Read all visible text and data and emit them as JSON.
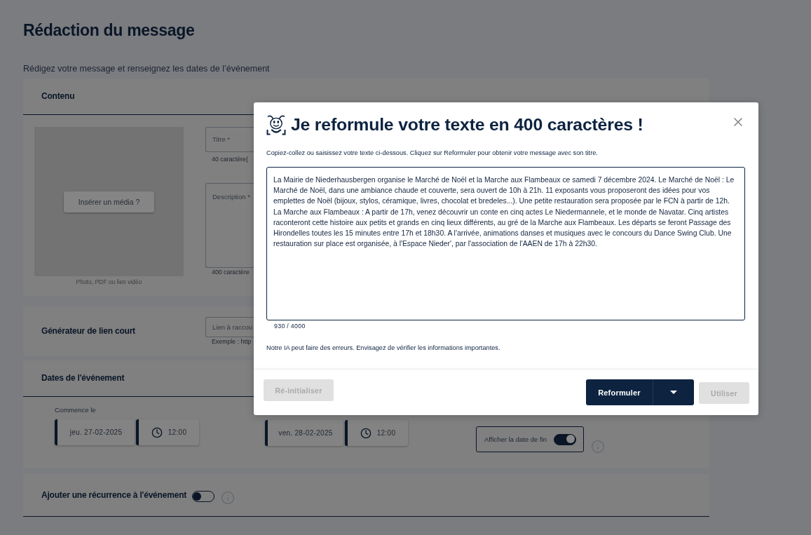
{
  "page": {
    "title": "Rédaction du message",
    "subtitle": "Rédigez votre message et renseignez les dates de l’événement"
  },
  "content_section": {
    "title": "Contenu",
    "media": {
      "button": "Insérer un média ?",
      "caption": "Photo, PDF ou lien vidéo"
    },
    "fields": [
      {
        "kind": "short",
        "label": "Titre *",
        "hint": "40 caractère("
      },
      {
        "kind": "long",
        "label": "Description *",
        "hint": "400 caractère"
      }
    ]
  },
  "short_link_section": {
    "title": "Générateur de lien court",
    "field": {
      "placeholder": "Lien à raccou"
    },
    "hint": "Exemple : http"
  },
  "dates_section": {
    "title": "Dates de l'événement",
    "start": {
      "label": "Commence le",
      "date": "jeu. 27-02-2025",
      "time": "12:00"
    },
    "end": {
      "date": "ven. 28-02-2025",
      "time": "12:00"
    },
    "show_end_date": {
      "label": "Afficher la date de fin",
      "on": true
    }
  },
  "recurrence_section": {
    "title": "Ajouter une récurrence à l'événement",
    "on": false
  },
  "modal": {
    "title": "Je reformule votre texte en 400 caractères !",
    "instructions": "Copiez-collez ou saisissez votre texte ci-dessous. Cliquez sur Reformuler pour obtenir votre message avec son titre.",
    "text": "La Mairie de Niederhausbergen organise le Marché de Noël et la Marche aux Flambeaux ce samedi 7 décembre 2024. Le Marché de Noël : Le Marché de Noël, dans une ambiance chaude et couverte, sera ouvert de 10h à 21h. 11 exposants vous proposeront des idées pour vos emplettes de Noël (bijoux, stylos, céramique, livres, chocolat et bredeles...). Une petite restauration sera proposée par le FCN à partir de 12h. La Marche aux Flambeaux : A partir de 17h, venez découvrir un conte en cinq actes Le Niedermannele, et le monde de Navatar. Cinq artistes raconteront cette histoire aux petits et grands en cinq lieux différents, au gré de la Marche aux Flambeaux. Les départs se feront Passage des Hirondelles toutes les 15 minutes entre 17h et 18h30. A l'arrivée, animations danses et musiques avec le concours du Dance Swing Club. Une restauration sur place est organisée, à l'Espace Nieder', par l'association de l'AAEN de 17h à 22h30.",
    "counter": "930 / 4000",
    "notice": "Notre IA peut faire des erreurs. Envisagez de vérifier les informations importantes.",
    "buttons": [
      {
        "kind": "secondary",
        "label": "Ré-initialiser",
        "disabled": true
      },
      {
        "kind": "split",
        "label": "Reformuler",
        "disabled": false
      },
      {
        "kind": "primary",
        "label": "Utiliser",
        "disabled": true
      }
    ]
  }
}
